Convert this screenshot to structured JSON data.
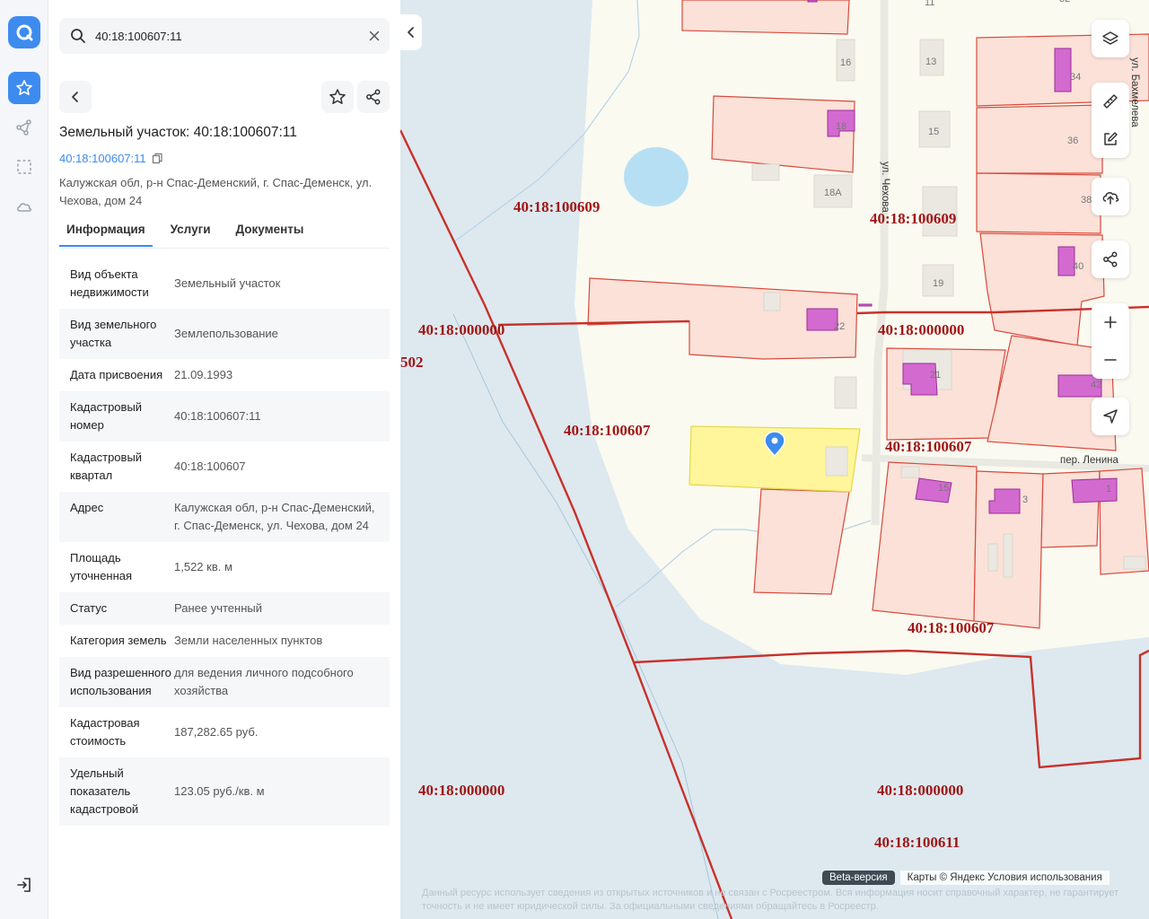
{
  "search": {
    "value": "40:18:100607:11"
  },
  "parcel": {
    "title": "Земельный участок: 40:18:100607:11",
    "cadastral_link": "40:18:100607:11",
    "address": "Калужская обл, р-н Спас-Деменский, г. Спас-Деменск, ул. Чехова, дом 24"
  },
  "tabs": [
    "Информация",
    "Услуги",
    "Документы"
  ],
  "info": [
    {
      "label": "Вид объекта недвижимости",
      "value": "Земельный участок"
    },
    {
      "label": "Вид земельного участка",
      "value": "Землепользование"
    },
    {
      "label": "Дата присвоения",
      "value": "21.09.1993"
    },
    {
      "label": "Кадастровый номер",
      "value": "40:18:100607:11"
    },
    {
      "label": "Кадастровый квартал",
      "value": "40:18:100607"
    },
    {
      "label": "Адрес",
      "value": "Калужская обл, р-н Спас-Деменский, г. Спас-Деменск, ул. Чехова, дом 24"
    },
    {
      "label": "Площадь уточненная",
      "value": "1,522 кв. м"
    },
    {
      "label": "Статус",
      "value": "Ранее учтенный"
    },
    {
      "label": "Категория земель",
      "value": "Земли населенных пунктов"
    },
    {
      "label": "Вид разрешенного использования",
      "value": "для ведения личного подсобного хозяйства"
    },
    {
      "label": "Кадастровая стоимость",
      "value": "187,282.65 руб."
    },
    {
      "label": "Удельный показатель кадастровой",
      "value": "123.05 руб./кв. м"
    }
  ],
  "map": {
    "quarter_labels": {
      "q1": "40:18:100609",
      "q2": "40:18:100609",
      "q3": "40:18:000000",
      "q4": "40:18:000000",
      "q5": "502",
      "q6": "40:18:100607",
      "q7": "40:18:100607",
      "q8": "40:18:100607",
      "q9": "40:18:000000",
      "q10": "40:18:000000",
      "q11": "40:18:100611"
    },
    "street_labels": {
      "chekhova": "ул. Чехова",
      "lenina": "пер. Ленина",
      "top": "ул. Бахмелева"
    },
    "house_numbers": {
      "h11": "11",
      "h32": "32",
      "h16": "16",
      "h13": "13",
      "h34": "34",
      "h18": "18",
      "h15": "15",
      "h36": "36",
      "h18a": "18А",
      "h38": "38",
      "h40": "40",
      "h19": "19",
      "h22": "22",
      "h21": "21",
      "h42": "42",
      "h15b": "15",
      "h3": "3",
      "h1": "1"
    },
    "beta_label": "Beta-версия",
    "attribution": "Карты © Яндекс  Условия использования",
    "disclaimer": "Данный ресурс использует сведения из открытых источников и не связан с Росреестром. Вся информация носит справочный характер, не гарантирует точность и не имеет юридической силы. За официальными сведениями обращайтесь в Росреестр."
  },
  "colors": {
    "accent": "#3d8bef",
    "parcel_fill": "#fbe1d8",
    "parcel_stroke": "#d9493c",
    "selected_fill": "#fff59a",
    "building": "#d36ad0",
    "quarter_line": "#c8312b",
    "label": "#a01616",
    "water": "#dde9ef",
    "land": "#fafaf1"
  }
}
